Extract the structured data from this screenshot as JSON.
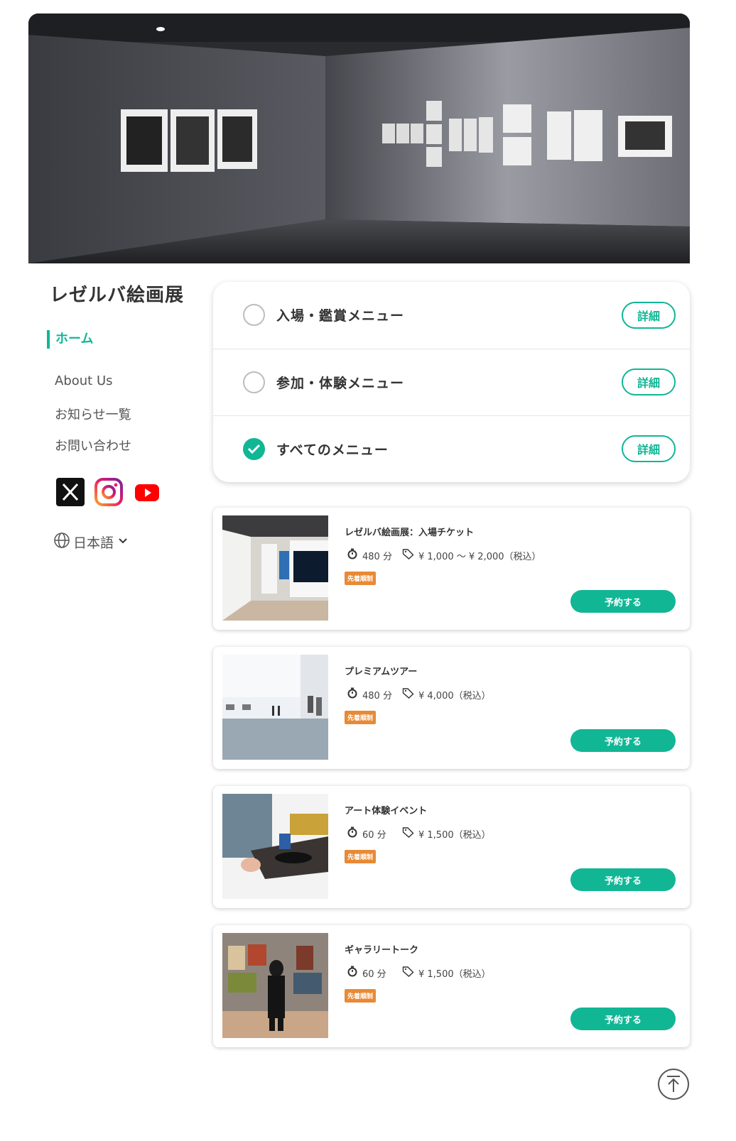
{
  "site": {
    "title": "レゼルバ絵画展"
  },
  "hero": {
    "image": "gallery-hall-photo"
  },
  "nav": {
    "home": "ホーム",
    "items": [
      "About Us",
      "お知らせ一覧",
      "お問い合わせ"
    ]
  },
  "social": {
    "icons": [
      "x-icon",
      "instagram-icon",
      "youtube-icon"
    ]
  },
  "language": {
    "label": "日本語"
  },
  "categories": [
    {
      "label": "入場・鑑賞メニュー",
      "detail": "詳細",
      "selected": false
    },
    {
      "label": "参加・体験メニュー",
      "detail": "詳細",
      "selected": false
    },
    {
      "label": "すべてのメニュー",
      "detail": "詳細",
      "selected": true
    }
  ],
  "events": [
    {
      "title": "レゼルバ絵画展：入場チケット",
      "duration": "480 分",
      "price": "¥ 1,000 ～ ¥ 2,000（税込）",
      "badge": "先着順制",
      "button": "予約する"
    },
    {
      "title": "プレミアムツアー",
      "duration": "480 分",
      "price": "¥ 4,000（税込）",
      "badge": "先着順制",
      "button": "予約する"
    },
    {
      "title": "アート体験イベント",
      "duration": "60 分",
      "price": "¥ 1,500（税込）",
      "badge": "先着順制",
      "button": "予約する"
    },
    {
      "title": "ギャラリートーク",
      "duration": "60 分",
      "price": "¥ 1,500（税込）",
      "badge": "先着順制",
      "button": "予約する"
    }
  ],
  "colors": {
    "accent": "#11b695",
    "badge": "#e88a35"
  }
}
